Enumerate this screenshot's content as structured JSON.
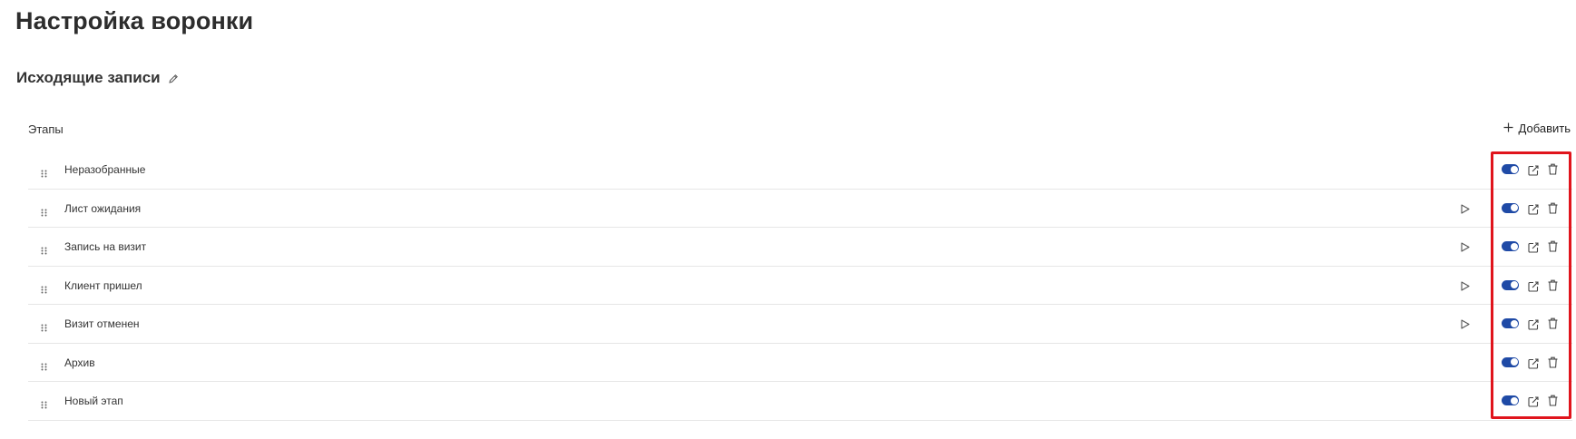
{
  "page": {
    "title": "Настройка воронки"
  },
  "funnel": {
    "name": "Исходящие записи"
  },
  "stages": {
    "header_label": "Этапы",
    "add_label": "Добавить",
    "items": [
      {
        "name": "Неразобранные",
        "has_play": false,
        "enabled": true
      },
      {
        "name": "Лист ожидания",
        "has_play": true,
        "enabled": true
      },
      {
        "name": "Запись на визит",
        "has_play": true,
        "enabled": true
      },
      {
        "name": "Клиент пришел",
        "has_play": true,
        "enabled": true
      },
      {
        "name": "Визит отменен",
        "has_play": true,
        "enabled": true
      },
      {
        "name": "Архив",
        "has_play": false,
        "enabled": true
      },
      {
        "name": "Новый этап",
        "has_play": false,
        "enabled": true
      }
    ]
  },
  "colors": {
    "toggle_on": "#1f4aa6",
    "highlight": "#e0141c"
  }
}
